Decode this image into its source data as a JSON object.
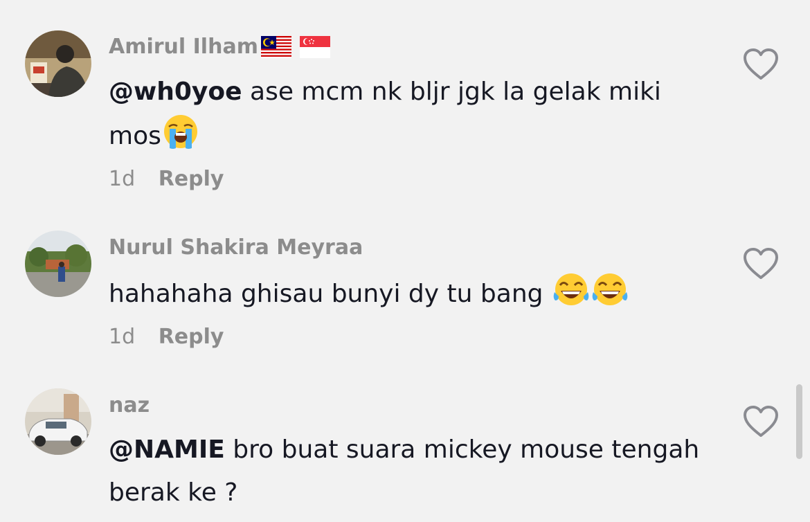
{
  "comments": [
    {
      "username": "Amirul Ilham",
      "flags": [
        "malaysia-flag-icon",
        "singapore-flag-icon"
      ],
      "mention": "@wh0yoe",
      "text": " ase mcm nk bljr jgk la gelak miki mos",
      "emoji": [
        "loudly-crying-face-icon"
      ],
      "time": "1d",
      "reply_label": "Reply"
    },
    {
      "username": "Nurul Shakira Meyraa",
      "mention": "",
      "text": "hahahaha ghisau bunyi dy tu bang ",
      "emoji": [
        "tears-of-joy-icon",
        "tears-of-joy-icon"
      ],
      "time": "1d",
      "reply_label": "Reply"
    },
    {
      "username": "naz",
      "mention": "@NAMIE",
      "text": " bro buat suara mickey mouse tengah berak ke ?",
      "emoji": []
    }
  ],
  "colors": {
    "background": "#f2f2f2",
    "text": "#161823",
    "secondary_text": "#8c8c8c"
  }
}
